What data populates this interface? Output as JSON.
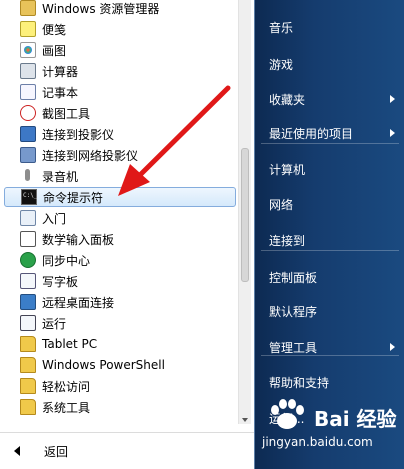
{
  "programs": [
    {
      "label": "Windows 资源管理器",
      "icon": "folder-explorer-icon",
      "cls": "win"
    },
    {
      "label": "便笺",
      "icon": "sticky-notes-icon",
      "cls": "note"
    },
    {
      "label": "画图",
      "icon": "paint-icon",
      "cls": "paint"
    },
    {
      "label": "计算器",
      "icon": "calculator-icon",
      "cls": "calc"
    },
    {
      "label": "记事本",
      "icon": "notepad-icon",
      "cls": "pad"
    },
    {
      "label": "截图工具",
      "icon": "snipping-tool-icon",
      "cls": "snip"
    },
    {
      "label": "连接到投影仪",
      "icon": "projector-icon",
      "cls": "proj"
    },
    {
      "label": "连接到网络投影仪",
      "icon": "network-projector-icon",
      "cls": "netproj"
    },
    {
      "label": "录音机",
      "icon": "microphone-icon",
      "cls": "rec"
    },
    {
      "label": "命令提示符",
      "icon": "command-prompt-icon",
      "cls": "cmd",
      "highlighted": true
    },
    {
      "label": "入门",
      "icon": "getting-started-icon",
      "cls": "intro"
    },
    {
      "label": "数学输入面板",
      "icon": "math-input-icon",
      "cls": "math"
    },
    {
      "label": "同步中心",
      "icon": "sync-center-icon",
      "cls": "sync"
    },
    {
      "label": "写字板",
      "icon": "wordpad-icon",
      "cls": "wpad"
    },
    {
      "label": "远程桌面连接",
      "icon": "remote-desktop-icon",
      "cls": "rdp"
    },
    {
      "label": "运行",
      "icon": "run-icon",
      "cls": "run"
    },
    {
      "label": "Tablet PC",
      "icon": "folder-icon",
      "cls": "folder"
    },
    {
      "label": "Windows PowerShell",
      "icon": "folder-icon",
      "cls": "folder"
    },
    {
      "label": "轻松访问",
      "icon": "folder-icon",
      "cls": "folder"
    },
    {
      "label": "系统工具",
      "icon": "folder-icon",
      "cls": "folder"
    }
  ],
  "back_label": "返回",
  "places": [
    {
      "label": "音乐",
      "submenu": false
    },
    {
      "label": "游戏",
      "submenu": false
    },
    {
      "label": "收藏夹",
      "submenu": true
    },
    {
      "label": "最近使用的项目",
      "submenu": true
    },
    {
      "label": "计算机",
      "submenu": false
    },
    {
      "label": "网络",
      "submenu": false
    },
    {
      "label": "连接到",
      "submenu": false
    },
    {
      "label": "控制面板",
      "submenu": false
    },
    {
      "label": "默认程序",
      "submenu": false
    },
    {
      "label": "管理工具",
      "submenu": true
    },
    {
      "label": "帮助和支持",
      "submenu": false
    },
    {
      "label": "运行...",
      "submenu": false
    }
  ],
  "watermark": {
    "brand": "Bai 经验",
    "url": "jingyan.baidu.com"
  },
  "colors": {
    "annotation_arrow": "#e01818",
    "highlight_border": "#84acdd",
    "places_bg": "#153c6e"
  }
}
